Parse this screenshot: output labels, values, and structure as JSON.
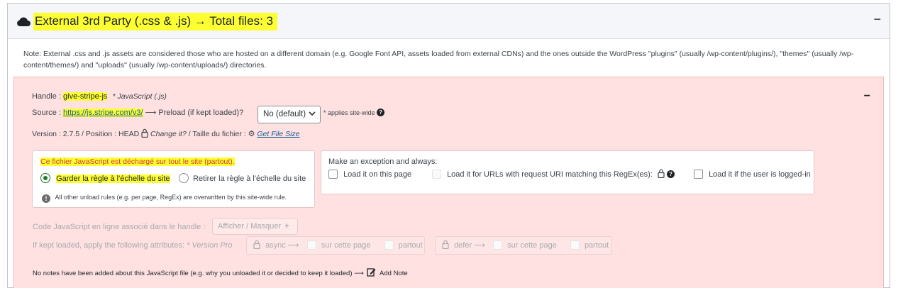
{
  "header": {
    "title": "External 3rd Party (.css & .js) → Total files: 3",
    "collapse_symbol": "−",
    "icon": "cloud-icon"
  },
  "note": "Note: External .css and .js assets are considered those who are hosted on a different domain (e.g. Google Font API, assets loaded from external CDNs) and the ones outside the WordPress \"plugins\" (usually /wp-content/plugins/), \"themes\" (usually /wp-content/themes/) and \"uploads\" (usually /wp-content/uploads/) directories.",
  "asset": {
    "collapse_symbol": "−",
    "handle_label": "Handle :",
    "handle_name": "give-stripe-js",
    "type_label": "* JavaScript (.js)",
    "source_label": "Source :",
    "source_url": "https://js.stripe.com/v3/",
    "arrow": "⟶",
    "preload_label": "Preload (if kept loaded)?",
    "preload_value": "No (default)",
    "preload_note": "* applies site-wide",
    "help_symbol": "?",
    "version_text": "Version : 2.7.5  /  Position : HEAD",
    "change_it": "Change it?",
    "file_size_label": "/  Taille du fichier :",
    "get_file_size": "Get File Size",
    "unload": {
      "title": "Ce fichier JavaScript est déchargé sur tout le site (partout).",
      "keep_rule": "Garder la règle à l'échelle du site",
      "remove_rule": "Retirer la règle à l'échelle du site",
      "info_symbol": "!",
      "info_text": "All other unload rules (e.g. per page, RegEx) are overwritten by this site-wide rule."
    },
    "exception": {
      "title": "Make an exception and always:",
      "load_on_page": "Load it on this page",
      "load_regex": "Load it for URLs with request URI matching this RegEx(es):",
      "load_logged_in": "Load it if the user is logged-in"
    },
    "inline_code_label": "Code JavaScript en ligne associé dans le handle :",
    "show_hide_button": "Afficher / Masquer",
    "plus": "+",
    "attributes_label": "If kept loaded, apply the following attributes:",
    "version_pro": "* Version Pro",
    "async_label": "async ⟶",
    "defer_label": "defer ⟶",
    "on_this_page": "sur cette page",
    "everywhere": "partout",
    "notes_text": "No notes have been added about this JavaScript file (e.g. why you unloaded it or decided to keep it loaded) ⟶",
    "add_note": "Add Note"
  },
  "colors": {
    "highlight": "#fdff32",
    "asset_bg": "#ffe1e1",
    "link": "#135e96",
    "radio_checked": "#1d7a2a"
  }
}
